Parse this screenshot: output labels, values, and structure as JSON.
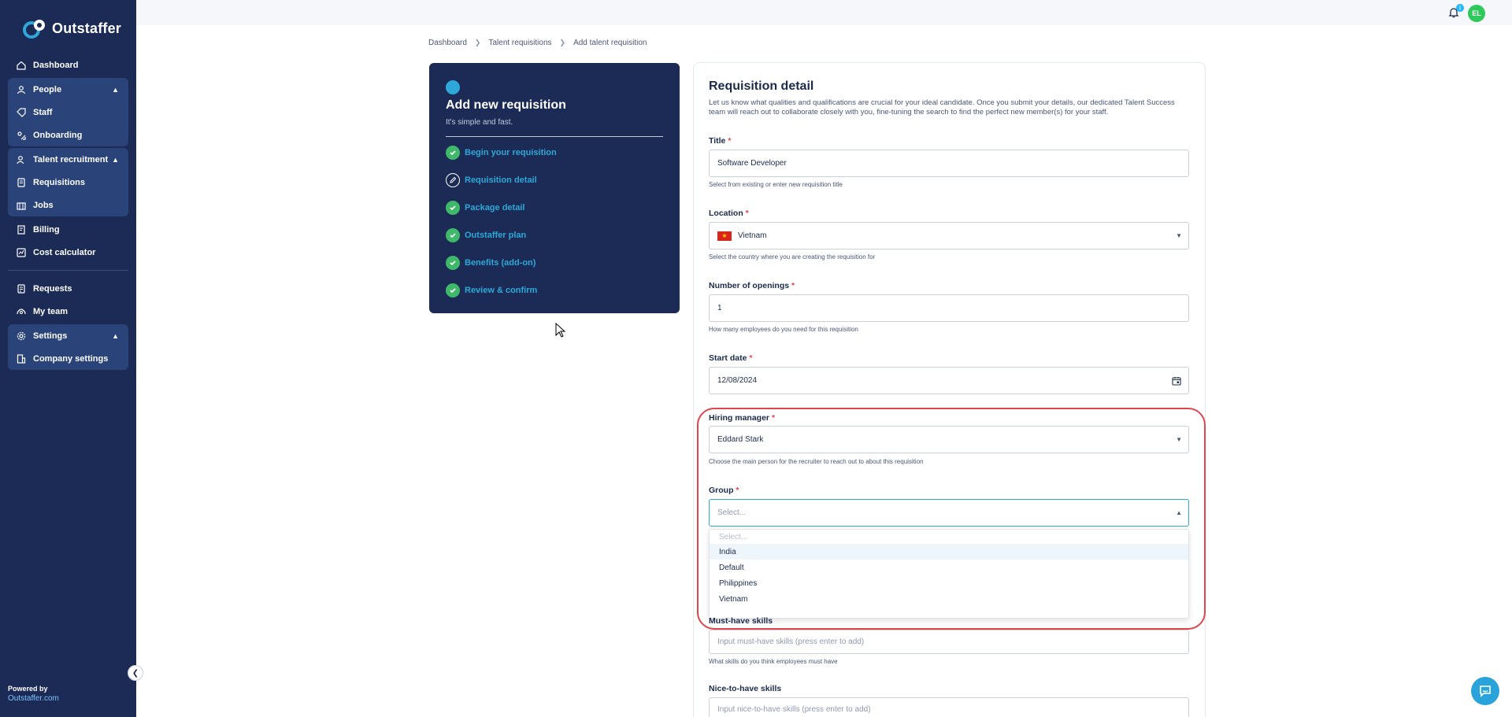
{
  "app": {
    "brand": "Outstaffer"
  },
  "sidebar": {
    "items": [
      {
        "label": "Dashboard",
        "icon": "home-icon"
      },
      {
        "label": "People",
        "icon": "person-icon"
      },
      {
        "label": "Staff",
        "icon": "tag-icon"
      },
      {
        "label": "Onboarding",
        "icon": "onboarding-icon"
      },
      {
        "label": "Talent recruitment",
        "icon": "person-search-icon"
      },
      {
        "label": "Requisitions",
        "icon": "document-icon"
      },
      {
        "label": "Jobs",
        "icon": "building-icon"
      },
      {
        "label": "Billing",
        "icon": "receipt-icon"
      },
      {
        "label": "Cost calculator",
        "icon": "calculator-icon"
      },
      {
        "label": "Requests",
        "icon": "requests-icon"
      },
      {
        "label": "My team",
        "icon": "team-icon"
      },
      {
        "label": "Settings",
        "icon": "gear-icon"
      },
      {
        "label": "Company settings",
        "icon": "company-icon"
      }
    ],
    "powered_by": "Powered by",
    "powered_link": "Outstaffer.com"
  },
  "topbar": {
    "notification_count": "1",
    "avatar_initials": "EL"
  },
  "breadcrumb": [
    "Dashboard",
    "Talent requisitions",
    "Add talent requisition"
  ],
  "steps_card": {
    "title": "Add new requisition",
    "subtitle": "It's simple and fast.",
    "steps": [
      {
        "label": "Begin your requisition",
        "state": "done"
      },
      {
        "label": "Requisition detail",
        "state": "current"
      },
      {
        "label": "Package detail",
        "state": "done"
      },
      {
        "label": "Outstaffer plan",
        "state": "done"
      },
      {
        "label": "Benefits (add-on)",
        "state": "done"
      },
      {
        "label": "Review & confirm",
        "state": "done"
      }
    ]
  },
  "form": {
    "title": "Requisition detail",
    "description": "Let us know what qualities and qualifications are crucial for your ideal candidate. Once you submit your details, our dedicated Talent Success team will reach out to collaborate closely with you, fine-tuning the search to find the perfect new member(s) for your staff.",
    "required_marker": "*",
    "title_field": {
      "label": "Title",
      "value": "Software Developer",
      "helper": "Select from existing or enter new requisition title"
    },
    "location": {
      "label": "Location",
      "value": "Vietnam",
      "helper": "Select the country where you are creating the requisition for"
    },
    "openings": {
      "label": "Number of openings",
      "value": "1",
      "helper": "How many employees do you need for this requisition"
    },
    "start_date": {
      "label": "Start date",
      "value": "12/08/2024"
    },
    "hiring_manager": {
      "label": "Hiring manager",
      "value": "Eddard Stark",
      "helper": "Choose the main person for the recruiter to reach out to about this requisition"
    },
    "group": {
      "label": "Group",
      "placeholder": "Select...",
      "options": [
        "Select...",
        "India",
        "Default",
        "Philippines",
        "Vietnam"
      ],
      "highlighted": "India"
    },
    "must_have": {
      "label": "Must-have skills",
      "placeholder": "Input must-have skills (press enter to add)",
      "helper": "What skills do you think employees must have"
    },
    "nice_to_have": {
      "label": "Nice-to-have skills",
      "placeholder": "Input nice-to-have skills (press enter to add)"
    }
  },
  "colors": {
    "sidebar": "#1b2b55",
    "accent": "#2ea8d8",
    "check": "#3fb86a",
    "required": "#e0444c",
    "highlight_outline": "#e0444c"
  }
}
